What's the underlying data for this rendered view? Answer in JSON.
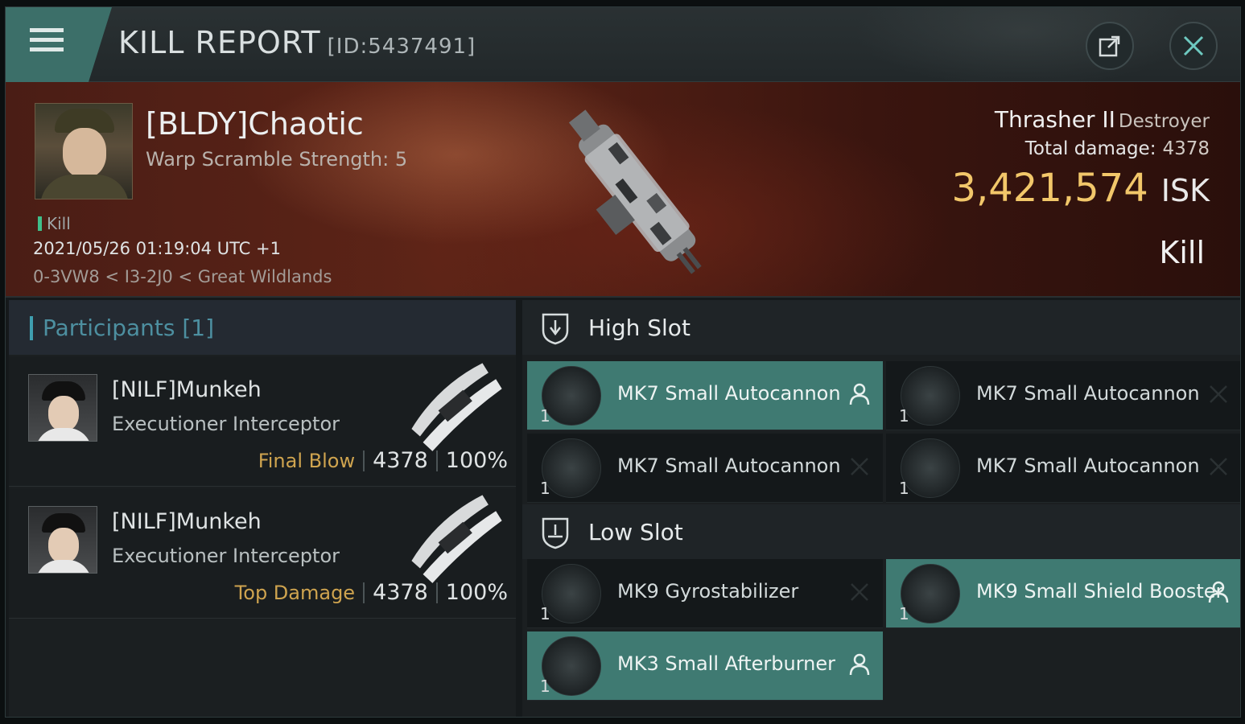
{
  "header": {
    "menu_icon": "hamburger-menu-icon",
    "title": "KILL REPORT",
    "id_text": "[ID:5437491]",
    "share_icon": "share-external-icon",
    "close_icon": "close-x-icon"
  },
  "victim": {
    "name": "[BLDY]Chaotic",
    "subtitle": "Warp Scramble Strength: 5",
    "kill_tag": "Kill",
    "datetime": "2021/05/26 01:19:04 UTC +1",
    "location": "0-3VW8 < I3-2J0 < Great Wildlands",
    "ship_name": "Thrasher II",
    "ship_class": "Destroyer",
    "total_damage_label": "Total damage:",
    "total_damage": "4378",
    "isk_value": "3,421,574",
    "isk_unit": "ISK",
    "result": "Kill"
  },
  "participants": {
    "title": "Participants [1]",
    "rows": [
      {
        "name": "[NILF]Munkeh",
        "ship": "Executioner Interceptor",
        "tag": "Final Blow",
        "damage": "4378",
        "percent": "100%"
      },
      {
        "name": "[NILF]Munkeh",
        "ship": "Executioner Interceptor",
        "tag": "Top Damage",
        "damage": "4378",
        "percent": "100%"
      }
    ]
  },
  "fitting": {
    "high_slot": {
      "label": "High Slot",
      "items": [
        {
          "name": "MK7 Small Autocannon",
          "qty": "1",
          "status": "fitted",
          "status_icon": "pilot-icon"
        },
        {
          "name": "MK7 Small Autocannon",
          "qty": "1",
          "status": "destroyed",
          "status_icon": "x-mark-icon"
        },
        {
          "name": "MK7 Small Autocannon",
          "qty": "1",
          "status": "destroyed",
          "status_icon": "x-mark-icon"
        },
        {
          "name": "MK7 Small Autocannon",
          "qty": "1",
          "status": "destroyed",
          "status_icon": "x-mark-icon"
        }
      ]
    },
    "low_slot": {
      "label": "Low Slot",
      "items": [
        {
          "name": "MK9 Gyrostabilizer",
          "qty": "1",
          "status": "destroyed",
          "status_icon": "x-mark-icon"
        },
        {
          "name": "MK9 Small Shield Booster",
          "qty": "1",
          "status": "fitted",
          "status_icon": "pilot-icon"
        },
        {
          "name": "MK3 Small Afterburner",
          "qty": "1",
          "status": "fitted",
          "status_icon": "pilot-icon"
        }
      ]
    }
  },
  "colors": {
    "accent_teal": "#3f7a72",
    "isk_gold": "#f2c76a",
    "tag_gold": "#cfa44f",
    "participants_blue": "#4d8fa0",
    "banner_red": "#5d2417"
  }
}
